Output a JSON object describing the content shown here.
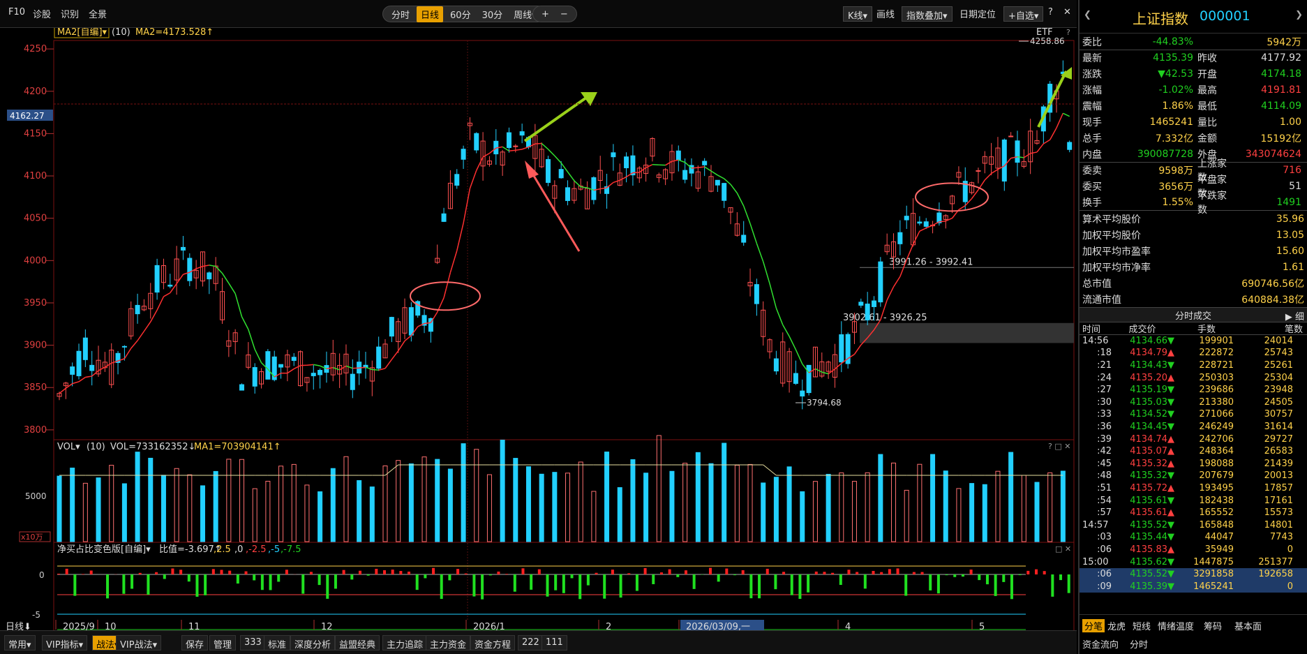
{
  "toolbar": {
    "f10": "F10",
    "diagnose": "诊股",
    "recognize": "识别",
    "fullview": "全景",
    "periods": [
      "分时",
      "日线",
      "60分",
      "30分",
      "周线▾"
    ],
    "active_period": "日线",
    "zoom_in": "+",
    "zoom_out": "−",
    "kline": "K线▾",
    "draw": "画线",
    "overlay": "指数叠加▾",
    "date_locate": "日期定位",
    "watchlist": "+自选▾",
    "help": "?",
    "close": "✕"
  },
  "main_chart": {
    "indicator_label": "MA2[自编]▾",
    "indicator_param": "(10)",
    "indicator_value": "MA2=4173.528↑",
    "etf": "ETF",
    "help": "?",
    "y_ticks": [
      "4250",
      "4200",
      "4150",
      "4100",
      "4050",
      "4000",
      "3950",
      "3900",
      "3850",
      "3800"
    ],
    "current_price": "4162.27",
    "high_label": "4258.86",
    "low_label": "3794.68",
    "gap1": "3991.26 - 3992.41",
    "gap2": "3902.61 - 3926.25"
  },
  "vol_chart": {
    "label": "VOL▾",
    "param": "(10)",
    "vol": "VOL=733162352↓",
    "ma1": "MA1=703904141↑",
    "tick": "5000",
    "unit": "x10万",
    "controls": "? □ ✕"
  },
  "net_chart": {
    "label": "净买占比变色版[自编]▾",
    "value": "比值=-3.697↑",
    "levels": [
      ",2.5",
      ",0",
      ",-2.5",
      ",-5",
      ",-7.5"
    ],
    "ticks": [
      "0",
      "-5"
    ],
    "controls": "□ ✕"
  },
  "x_axis": {
    "mode": "日线⬇",
    "labels": [
      "2025/9",
      "10",
      "11",
      "12",
      "2026/1",
      "2",
      "2026/03/09,一",
      "4",
      "5"
    ]
  },
  "bottom": {
    "items": [
      "常用▾",
      "VIP指标▾",
      "战法▾",
      "VIP战法▾",
      "保存",
      "管理",
      "333",
      "标准",
      "深度分析",
      "益盟经典",
      "主力追踪",
      "主力资金",
      "资金方程",
      "222",
      "111"
    ],
    "active": "战法▾"
  },
  "panel": {
    "name": "上证指数",
    "code": "000001",
    "rows": [
      {
        "k": "委比",
        "v": "-44.83%",
        "vc": "dn",
        "k2": "",
        "v2": "5942万",
        "v2c": "yel"
      },
      {
        "k": "最新",
        "v": "4135.39",
        "vc": "dn",
        "k2": "昨收",
        "v2": "4177.92",
        "v2c": "wh"
      },
      {
        "k": "涨跌",
        "v": "▼42.53",
        "vc": "dn",
        "k2": "开盘",
        "v2": "4174.18",
        "v2c": "dn"
      },
      {
        "k": "涨幅",
        "v": "-1.02%",
        "vc": "dn",
        "k2": "最高",
        "v2": "4191.81",
        "v2c": "up"
      },
      {
        "k": "震幅",
        "v": "1.86%",
        "vc": "yel",
        "k2": "最低",
        "v2": "4114.09",
        "v2c": "dn"
      },
      {
        "k": "现手",
        "v": "1465241",
        "vc": "yel",
        "k2": "量比",
        "v2": "1.00",
        "v2c": "yel"
      },
      {
        "k": "总手",
        "v": "7.332亿",
        "vc": "yel",
        "k2": "金额",
        "v2": "15192亿",
        "v2c": "yel"
      },
      {
        "k": "内盘",
        "v": "390087728",
        "vc": "dn",
        "k2": "外盘",
        "v2": "343074624",
        "v2c": "up"
      },
      {
        "k": "委卖",
        "v": "9598万",
        "vc": "yel",
        "k2": "上涨家数",
        "v2": "716",
        "v2c": "up"
      },
      {
        "k": "委买",
        "v": "3656万",
        "vc": "yel",
        "k2": "平盘家数",
        "v2": "51",
        "v2c": "wh"
      },
      {
        "k": "换手",
        "v": "1.55%",
        "vc": "yel",
        "k2": "下跌家数",
        "v2": "1491",
        "v2c": "dn"
      }
    ],
    "stats": [
      {
        "k": "算术平均股价",
        "v": "35.96"
      },
      {
        "k": "加权平均股价",
        "v": "13.05"
      },
      {
        "k": "加权平均市盈率",
        "v": "15.60"
      },
      {
        "k": "加权平均市净率",
        "v": "1.61"
      },
      {
        "k": "总市值",
        "v": "690746.56亿"
      },
      {
        "k": "流通市值",
        "v": "640884.38亿"
      }
    ],
    "trade_title": "分时成交",
    "trade_btn": "▶ 细",
    "trade_cols": [
      "时间",
      "成交价",
      "手数",
      "笔数"
    ],
    "trades": [
      {
        "t": "14:56",
        "p": "4134.66▼",
        "pc": "dn",
        "h": "199901",
        "b": "24014"
      },
      {
        "t": ":18",
        "p": "4134.79▲",
        "pc": "up",
        "h": "222872",
        "b": "25743"
      },
      {
        "t": ":21",
        "p": "4134.43▼",
        "pc": "dn",
        "h": "228721",
        "b": "25261"
      },
      {
        "t": ":24",
        "p": "4135.20▲",
        "pc": "up",
        "h": "250303",
        "b": "25304"
      },
      {
        "t": ":27",
        "p": "4135.19▼",
        "pc": "dn",
        "h": "239686",
        "b": "23948"
      },
      {
        "t": ":30",
        "p": "4135.03▼",
        "pc": "dn",
        "h": "213380",
        "b": "24505"
      },
      {
        "t": ":33",
        "p": "4134.52▼",
        "pc": "dn",
        "h": "271066",
        "b": "30757"
      },
      {
        "t": ":36",
        "p": "4134.45▼",
        "pc": "dn",
        "h": "246249",
        "b": "31614"
      },
      {
        "t": ":39",
        "p": "4134.74▲",
        "pc": "up",
        "h": "242706",
        "b": "29727"
      },
      {
        "t": ":42",
        "p": "4135.07▲",
        "pc": "up",
        "h": "248364",
        "b": "26583"
      },
      {
        "t": ":45",
        "p": "4135.32▲",
        "pc": "up",
        "h": "198088",
        "b": "21439"
      },
      {
        "t": ":48",
        "p": "4135.32▼",
        "pc": "dn",
        "h": "207679",
        "b": "20013"
      },
      {
        "t": ":51",
        "p": "4135.72▲",
        "pc": "up",
        "h": "193495",
        "b": "17857"
      },
      {
        "t": ":54",
        "p": "4135.61▼",
        "pc": "dn",
        "h": "182438",
        "b": "17161"
      },
      {
        "t": ":57",
        "p": "4135.61▲",
        "pc": "up",
        "h": "165552",
        "b": "15573"
      },
      {
        "t": "14:57",
        "p": "4135.52▼",
        "pc": "dn",
        "h": "165848",
        "b": "14801"
      },
      {
        "t": ":03",
        "p": "4135.44▼",
        "pc": "dn",
        "h": "44047",
        "b": "7743"
      },
      {
        "t": ":06",
        "p": "4135.83▲",
        "pc": "up",
        "h": "35949",
        "b": "0"
      },
      {
        "t": "15:00",
        "p": "4135.62▼",
        "pc": "dn",
        "h": "1447875",
        "b": "251377"
      },
      {
        "t": ":06",
        "p": "4135.52▼",
        "pc": "dn",
        "h": "3291858",
        "b": "192658"
      },
      {
        "t": ":09",
        "p": "4135.39▼",
        "pc": "dn",
        "h": "1465241",
        "b": "0"
      }
    ],
    "tabs1": [
      "分笔",
      "龙虎",
      "短线",
      "情绪温度",
      "筹码",
      "基本面"
    ],
    "tabs2": [
      "资金流向",
      "分时"
    ],
    "active_tab": "分笔"
  }
}
